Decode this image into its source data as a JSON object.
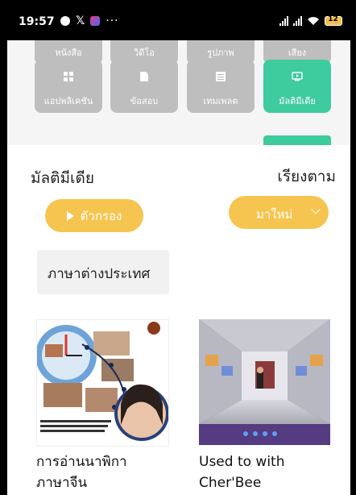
{
  "status_bar": {
    "time": "19:57",
    "more": "···",
    "battery": "12"
  },
  "categories": {
    "row1_partial": [
      "หนังสือ",
      "วิดีโอ",
      "รูปภาพ",
      "เสียง"
    ],
    "row2": [
      {
        "label": "แอปพลิเคชัน",
        "icon": "grid-icon"
      },
      {
        "label": "ข้อสอบ",
        "icon": "document-icon"
      },
      {
        "label": "เทมเพลต",
        "icon": "list-icon"
      },
      {
        "label": "มัลติมีเดีย",
        "icon": "multimedia-icon",
        "active": true
      }
    ]
  },
  "section": {
    "title": "มัลติมีเดีย",
    "sort_label": "เรียงตาม"
  },
  "filter": {
    "button_label": "ตัวกรอง"
  },
  "sort": {
    "selected": "มาใหม่"
  },
  "language_tag": "ภาษาต่างประเทศ",
  "items": [
    {
      "caption_line1": "การอ่านนาพิกา",
      "caption_line2": "ภาษาจีน"
    },
    {
      "caption_line1": "Used to with",
      "caption_line2": "Cher'Bee"
    }
  ],
  "colors": {
    "accent_yellow": "#f6c54f",
    "active_teal": "#3ecb9d",
    "inactive_gray": "#bebebe"
  }
}
